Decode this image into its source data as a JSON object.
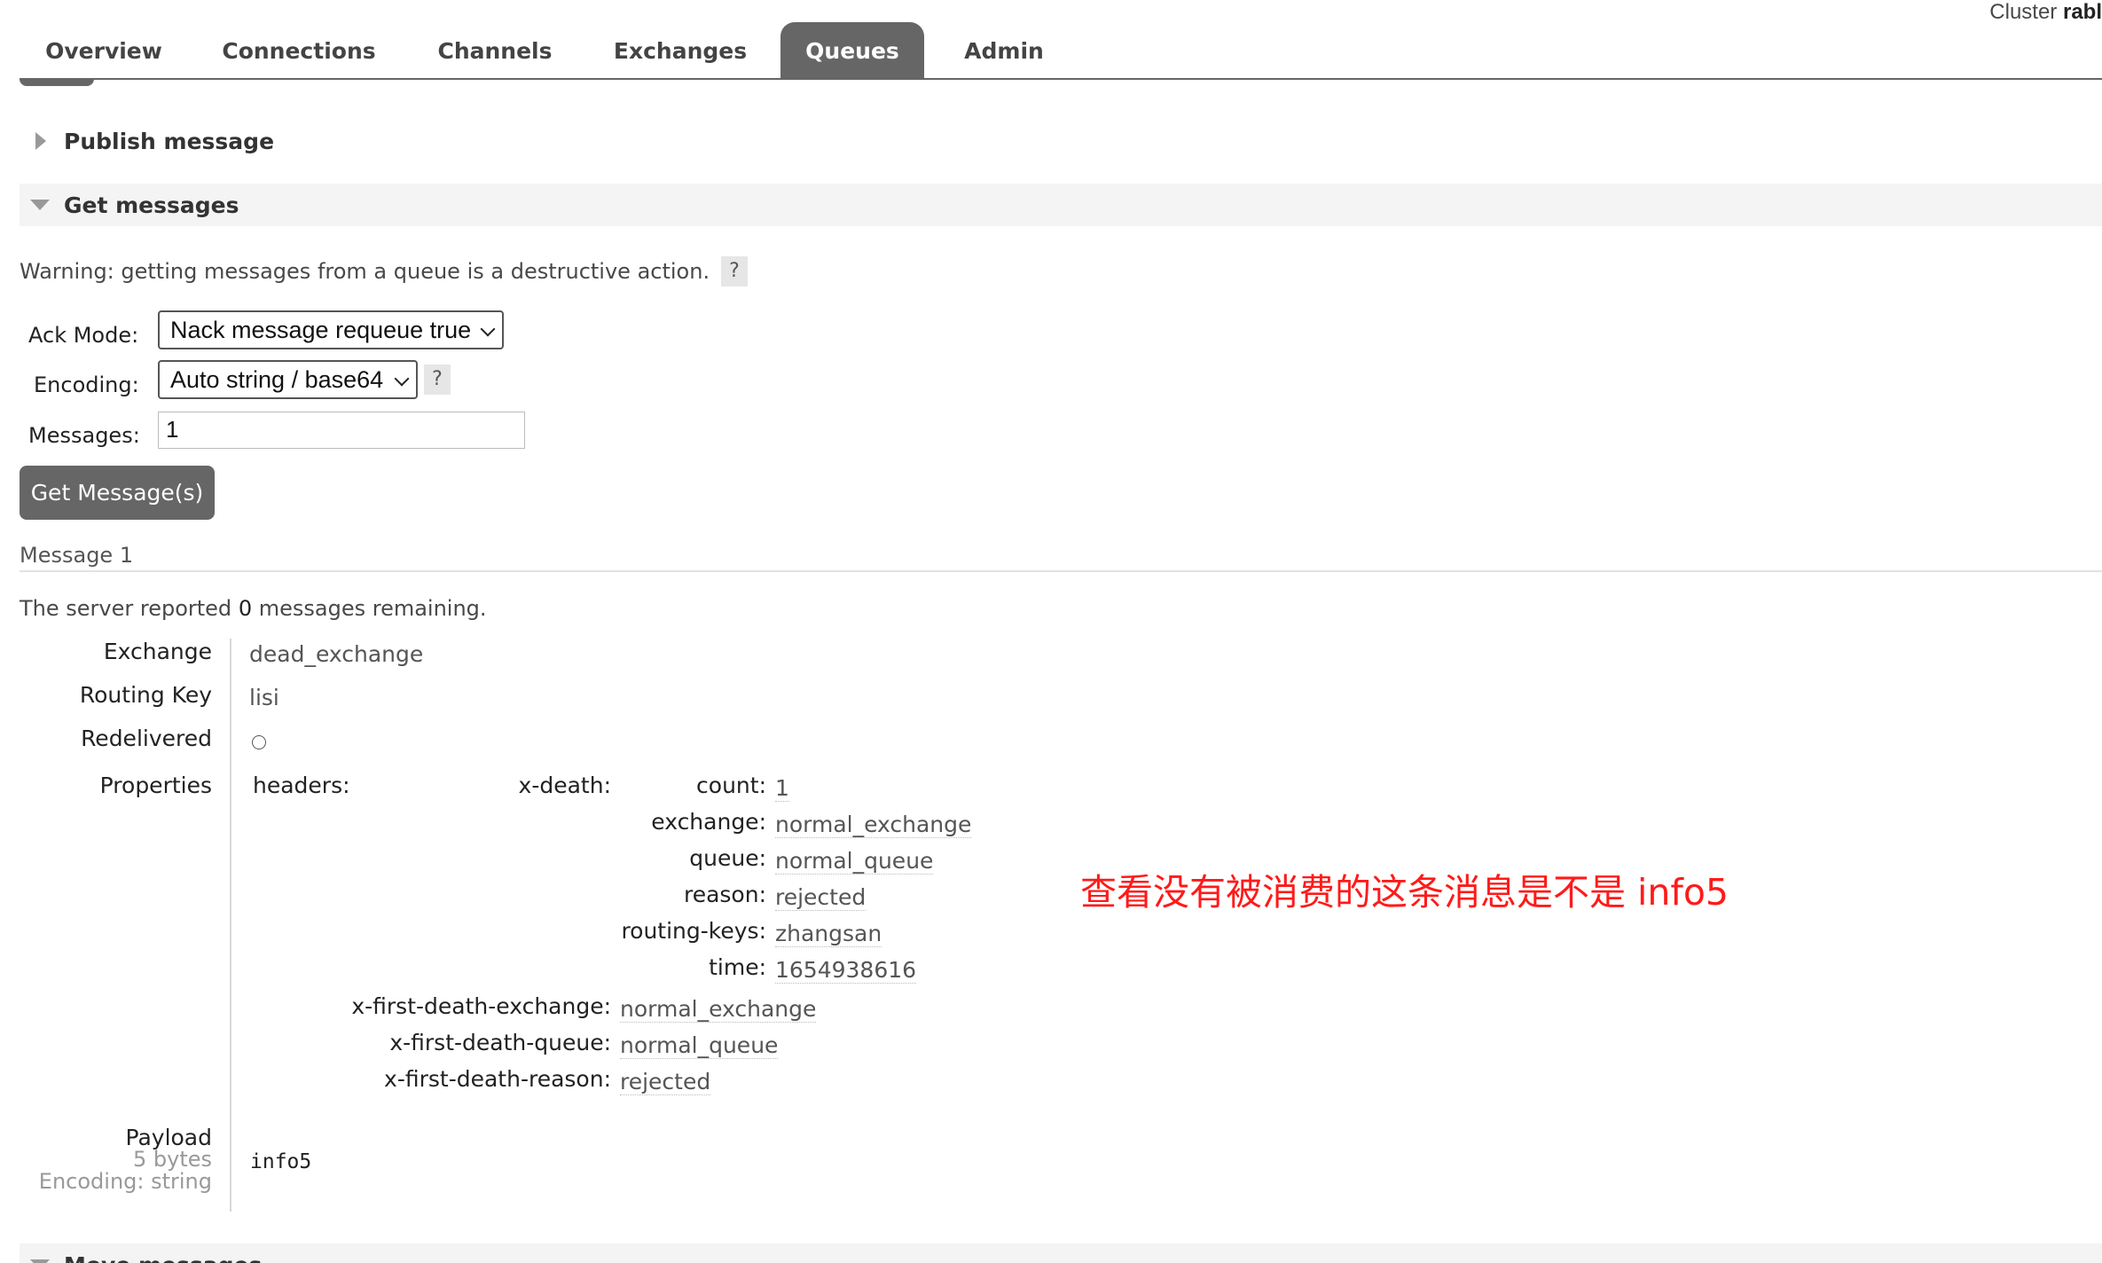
{
  "header": {
    "cluster_prefix": "Cluster",
    "cluster_name": "rabl"
  },
  "nav": {
    "tabs": [
      {
        "label": "Overview"
      },
      {
        "label": "Connections"
      },
      {
        "label": "Channels"
      },
      {
        "label": "Exchanges"
      },
      {
        "label": "Queues",
        "active": true
      },
      {
        "label": "Admin"
      }
    ]
  },
  "sections": {
    "publish": "Publish message",
    "get": "Get messages",
    "move": "Move messages"
  },
  "get_messages": {
    "warning": "Warning: getting messages from a queue is a destructive action.",
    "help": "?",
    "ack_mode_label": "Ack Mode:",
    "ack_mode_value": "Nack message requeue true",
    "encoding_label": "Encoding:",
    "encoding_value": "Auto string / base64",
    "messages_label": "Messages:",
    "messages_value": "1",
    "button": "Get Message(s)"
  },
  "message": {
    "title": "Message 1",
    "remaining_prefix": "The server reported",
    "remaining_count": "0",
    "remaining_suffix": "messages remaining.",
    "exchange_label": "Exchange",
    "exchange": "dead_exchange",
    "routing_key_label": "Routing Key",
    "routing_key": "lisi",
    "redelivered_label": "Redelivered",
    "redelivered_value": "○",
    "properties_label": "Properties",
    "headers_label": "headers:",
    "x_death_label": "x-death:",
    "x_death": [
      {
        "key": "count:",
        "value": "1"
      },
      {
        "key": "exchange:",
        "value": "normal_exchange"
      },
      {
        "key": "queue:",
        "value": "normal_queue"
      },
      {
        "key": "reason:",
        "value": "rejected"
      },
      {
        "key": "routing-keys:",
        "value": "zhangsan"
      },
      {
        "key": "time:",
        "value": "1654938616"
      }
    ],
    "first_death": [
      {
        "key": "x-first-death-exchange:",
        "value": "normal_exchange"
      },
      {
        "key": "x-first-death-queue:",
        "value": "normal_queue"
      },
      {
        "key": "x-first-death-reason:",
        "value": "rejected"
      }
    ],
    "payload_label": "Payload",
    "payload_size": "5 bytes",
    "payload_encoding": "Encoding: string",
    "payload": "info5"
  },
  "annotation": "查看没有被消费的这条消息是不是 info5"
}
